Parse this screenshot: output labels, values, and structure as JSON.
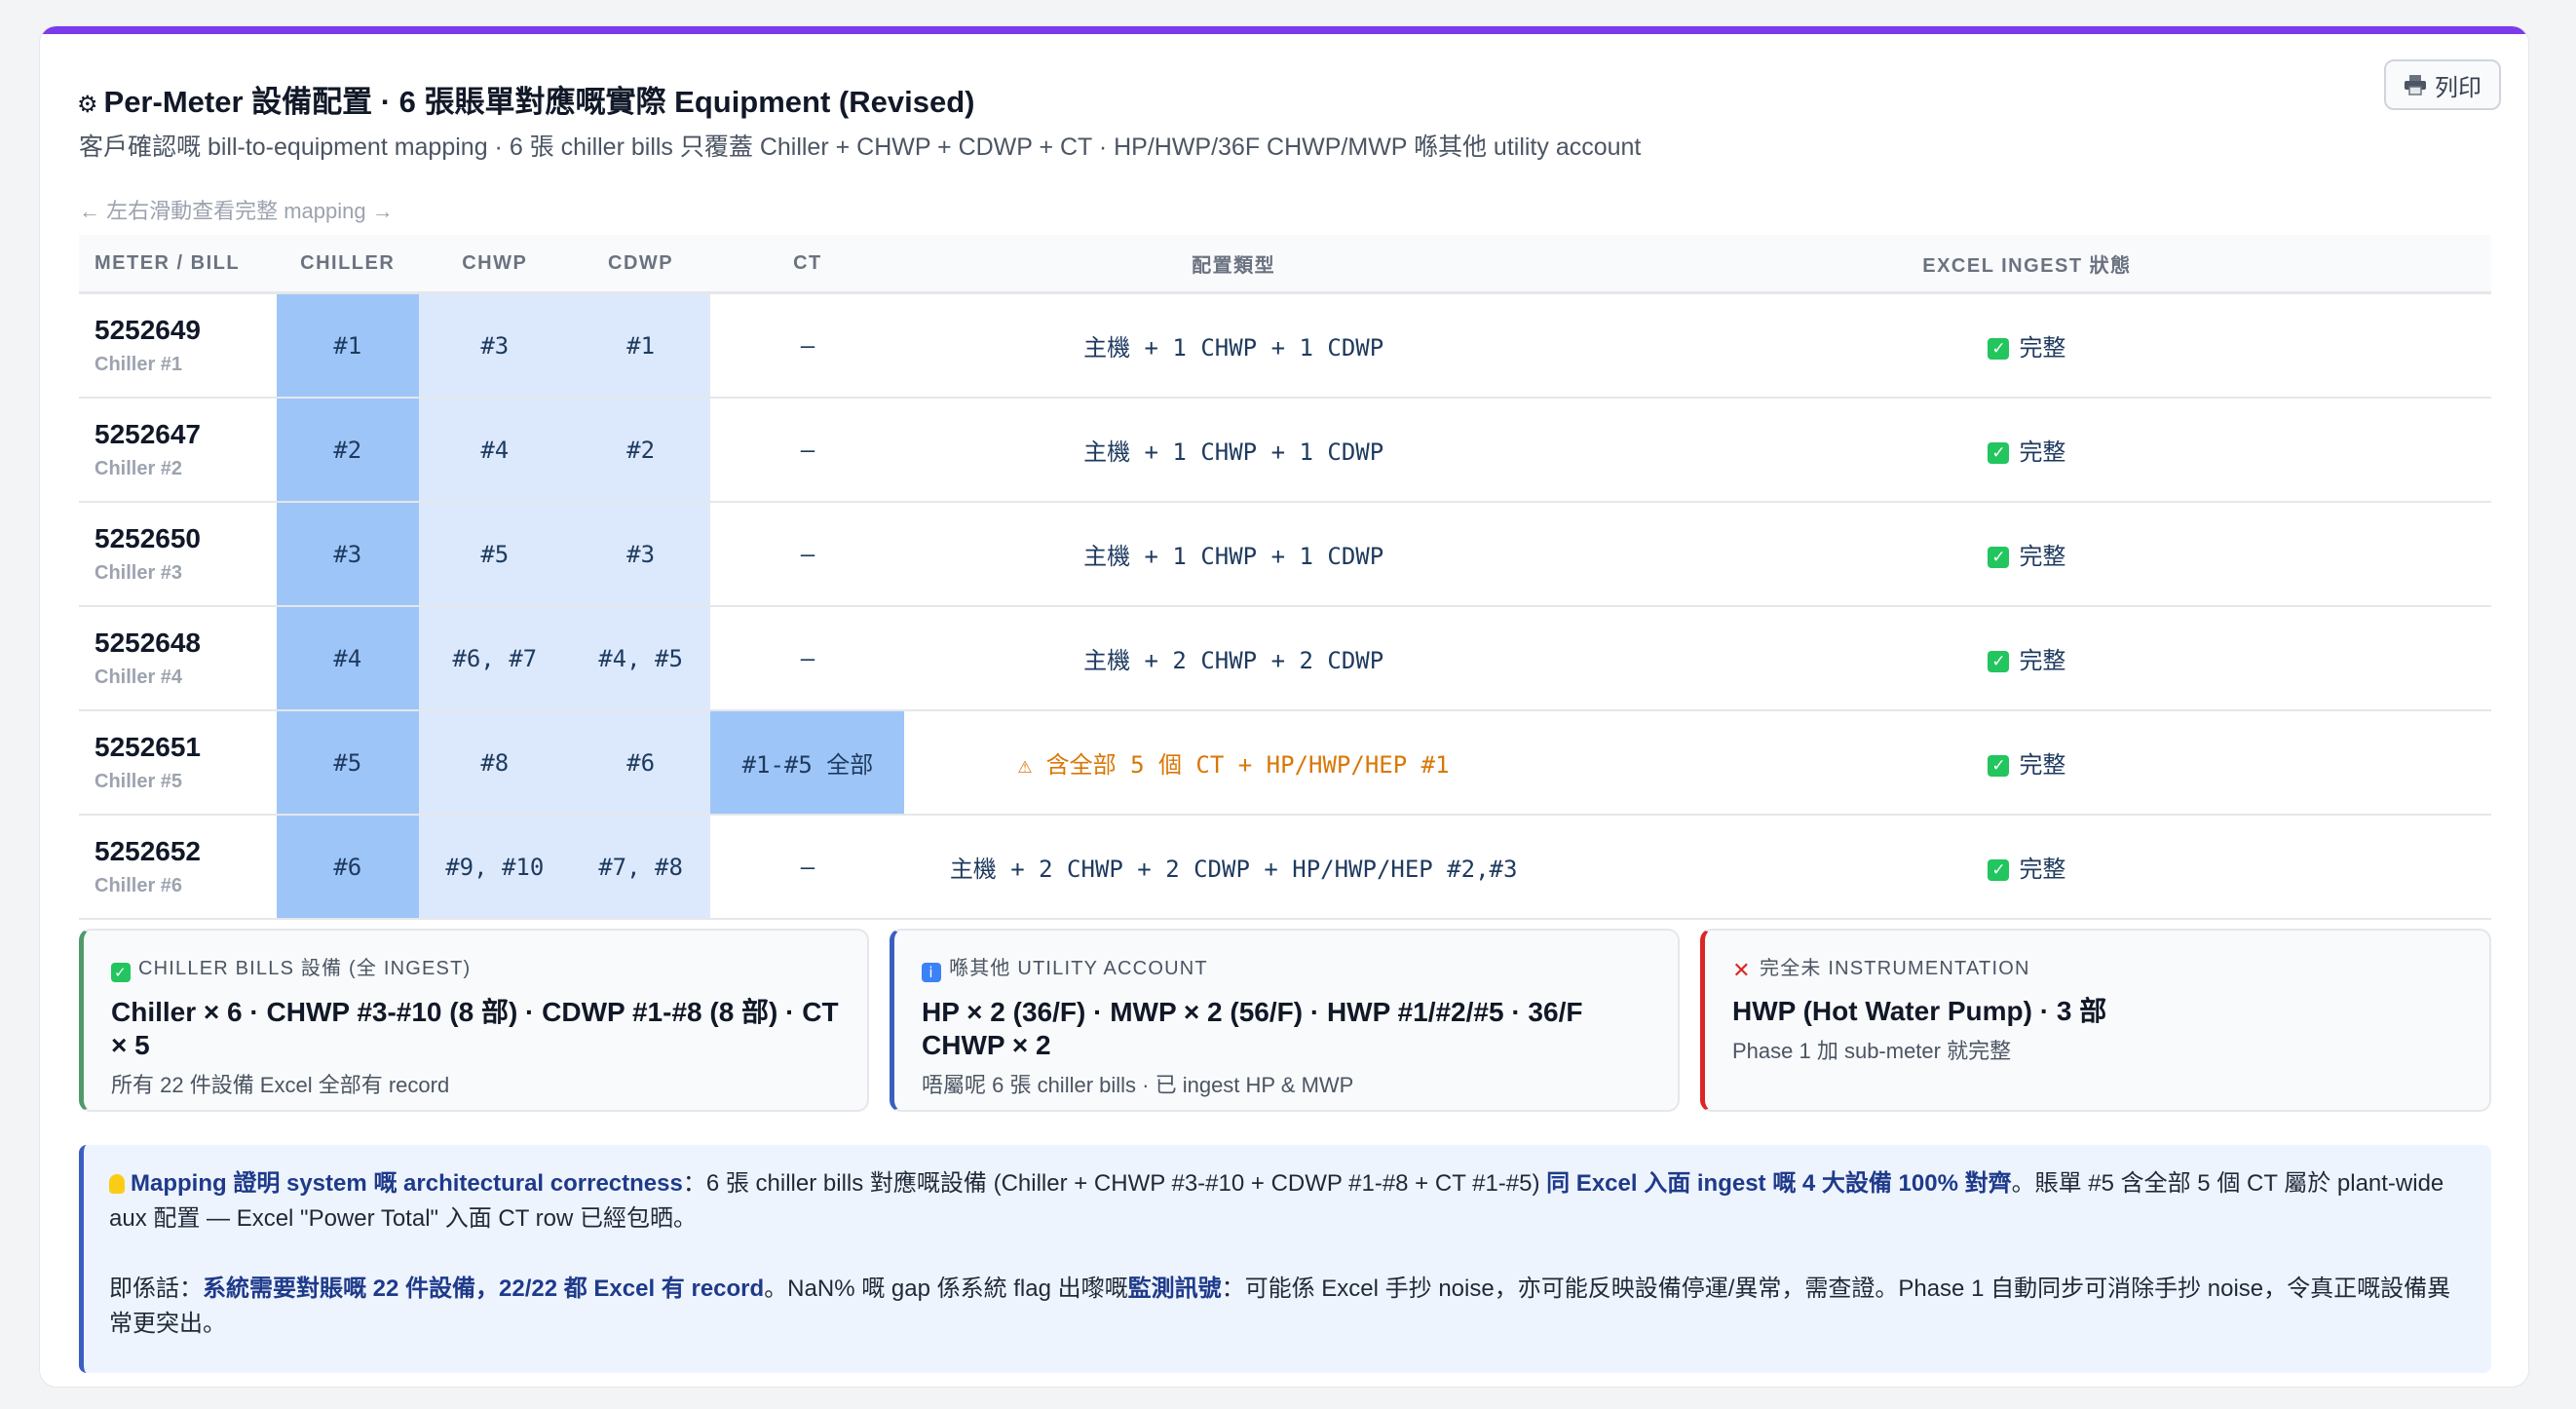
{
  "header": {
    "title_icon": "⚙",
    "title": "Per-Meter 設備配置 · 6 張賬單對應嘅實際 Equipment (Revised)",
    "subtitle": "客戶確認嘅 bill-to-equipment mapping · 6 張 chiller bills 只覆蓋 Chiller + CHWP + CDWP + CT · HP/HWP/36F CHWP/MWP 喺其他 utility account",
    "print_label": "列印",
    "scroll_hint": "← 左右滑動查看完整 mapping →"
  },
  "table": {
    "columns": [
      "METER / BILL",
      "CHILLER",
      "CHWP",
      "CDWP",
      "CT",
      "配置類型",
      "EXCEL INGEST 狀態"
    ],
    "rows": [
      {
        "meter": "5252649",
        "label": "Chiller #1",
        "chiller": "#1",
        "chwp": "#3",
        "cdwp": "#1",
        "ct": "—",
        "config": "主機 + 1 CHWP + 1 CDWP",
        "status": "完整"
      },
      {
        "meter": "5252647",
        "label": "Chiller #2",
        "chiller": "#2",
        "chwp": "#4",
        "cdwp": "#2",
        "ct": "—",
        "config": "主機 + 1 CHWP + 1 CDWP",
        "status": "完整"
      },
      {
        "meter": "5252650",
        "label": "Chiller #3",
        "chiller": "#3",
        "chwp": "#5",
        "cdwp": "#3",
        "ct": "—",
        "config": "主機 + 1 CHWP + 1 CDWP",
        "status": "完整"
      },
      {
        "meter": "5252648",
        "label": "Chiller #4",
        "chiller": "#4",
        "chwp": "#6, #7",
        "cdwp": "#4, #5",
        "ct": "—",
        "config": "主機 + 2 CHWP + 2 CDWP",
        "status": "完整"
      },
      {
        "meter": "5252651",
        "label": "Chiller #5",
        "chiller": "#5",
        "chwp": "#8",
        "cdwp": "#6",
        "ct": "#1-#5 全部",
        "config": "⚠ 含全部 5 個 CT + HP/HWP/HEP #1",
        "status": "完整"
      },
      {
        "meter": "5252652",
        "label": "Chiller #6",
        "chiller": "#6",
        "chwp": "#9, #10",
        "cdwp": "#7, #8",
        "ct": "—",
        "config": "主機 + 2 CHWP + 2 CDWP + HP/HWP/HEP #2,#3",
        "status": "完整"
      }
    ]
  },
  "legend": {
    "ingested": {
      "head": "CHILLER BILLS 設備 (全 INGEST)",
      "main": "Chiller × 6 · CHWP #3-#10 (8 部) · CDWP #1-#8 (8 部) · CT × 5",
      "sub": "所有 22 件設備 Excel 全部有 record"
    },
    "other_account": {
      "head": "喺其他 UTILITY ACCOUNT",
      "main": "HP × 2 (36/F) · MWP × 2 (56/F) · HWP #1/#2/#5 · 36/F CHWP × 2",
      "sub": "唔屬呢 6 張 chiller bills · 已 ingest HP & MWP"
    },
    "no_instrumentation": {
      "head": "完全未 INSTRUMENTATION",
      "main": "HWP (Hot Water Pump) · 3 部",
      "sub": "Phase 1 加 sub-meter 就完整"
    }
  },
  "note": {
    "p1_bold": "Mapping 證明 system 嘅 architectural correctness",
    "p1_text": "：6 張 chiller bills 對應嘅設備 (Chiller + CHWP #3-#10 + CDWP #1-#8 + CT #1-#5) ",
    "p1_bold2": "同 Excel 入面 ingest 嘅 4 大設備 100% 對齊",
    "p1_text2": "。賬單 #5 含全部 5 個 CT 屬於 plant-wide aux 配置 — Excel \"Power Total\" 入面 CT row 已經包晒。",
    "p2_prefix": "即係話：",
    "p2_bold": "系統需要對賬嘅 22 件設備，22/22 都 Excel 有 record",
    "p2_text": "。NaN% 嘅 gap 係系統 flag 出嚟嘅",
    "p2_bold2": "監測訊號",
    "p2_text2": "：可能係 Excel 手抄 noise，亦可能反映設備停運/異常，需查證。Phase 1 自動同步可消除手抄 noise，令真正嘅設備異常更突出。"
  },
  "colors": {
    "accent_bar": "#7c3aed",
    "chiller_cell": "#9ec5f8",
    "pump_cell": "#dce9fc",
    "ok_green": "#16a34a",
    "warn_orange": "#d97706"
  }
}
